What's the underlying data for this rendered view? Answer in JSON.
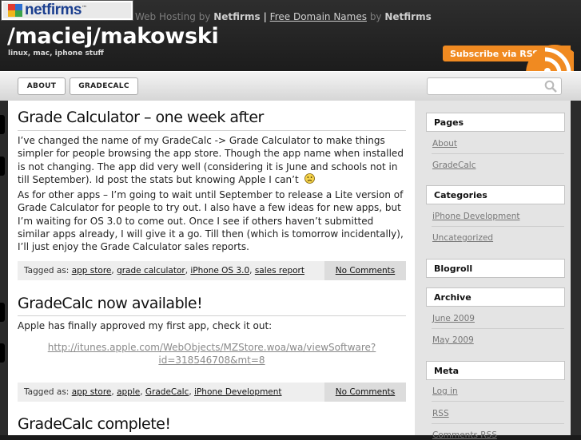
{
  "banner": {
    "logo_text": "netfirms",
    "logo_tm": "™",
    "host_prefix": "Web Hosting",
    "host_by1": "by",
    "host_brand1": "Netfirms",
    "host_sep": "|",
    "free_domain": "Free Domain Names",
    "host_by2": "by",
    "host_brand2": "Netfirms"
  },
  "site": {
    "title": "/maciej/makowski",
    "tagline": "linux, mac, iphone stuff",
    "rss_label": "Subscribe via RSS"
  },
  "nav": {
    "items": [
      {
        "label": "ABOUT"
      },
      {
        "label": "GRADECALC"
      }
    ],
    "search_placeholder": ""
  },
  "posts": [
    {
      "title": "Grade Calculator – one week after",
      "paragraphs": [
        "I’ve changed the name of my GradeCalc -> Grade Calculator to make things simpler for people browsing the app store. Though the app name when installed is not changing. The app did very well (considering it is June and schools not in till September). Id post the stats but knowing Apple I can’t",
        "As for other apps – I’m going to wait until September to release a Lite version of Grade Calculator for people to try out. I also have a few ideas for new apps, but I’m waiting for OS 3.0 to come out. Once I see if others haven’t submitted similar apps already, I will give it a go. Till then (which is tomorrow incidentally), I’ll just enjoy the Grade Calculator sales reports."
      ],
      "tagged_label": "Tagged as:",
      "tags": [
        "app store",
        "grade calculator",
        "iPhone OS 3.0",
        "sales report"
      ],
      "comments": "No Comments"
    },
    {
      "title": "GradeCalc now available!",
      "paragraphs": [
        "Apple has finally approved my first app, check it out:"
      ],
      "link_line1": "http://itunes.apple.com/WebObjects/MZStore.woa/wa/viewSoftware?",
      "link_line2": "id=318546708&mt=8",
      "tagged_label": "Tagged as:",
      "tags": [
        "app store",
        "apple",
        "GradeCalc",
        "iPhone Development"
      ],
      "comments": "No Comments"
    },
    {
      "title": "GradeCalc complete!"
    }
  ],
  "sidebar": {
    "pages": {
      "title": "Pages",
      "items": [
        "About",
        "GradeCalc"
      ]
    },
    "categories": {
      "title": "Categories",
      "items": [
        "iPhone Development",
        "Uncategorized"
      ]
    },
    "blogroll": {
      "title": "Blogroll"
    },
    "archive": {
      "title": "Archive",
      "items": [
        "June 2009",
        "May 2009"
      ]
    },
    "meta": {
      "title": "Meta",
      "items": [
        "Log in",
        "RSS",
        "Comments RSS"
      ]
    }
  },
  "colors": {
    "accent_orange": "#f08a21",
    "header_dark": "#1b1b1b",
    "sidebar_bg": "#e4e4e4"
  },
  "icons": [
    "netfirms-logo-icon",
    "rss-icon",
    "search-icon",
    "sad-face-icon"
  ]
}
